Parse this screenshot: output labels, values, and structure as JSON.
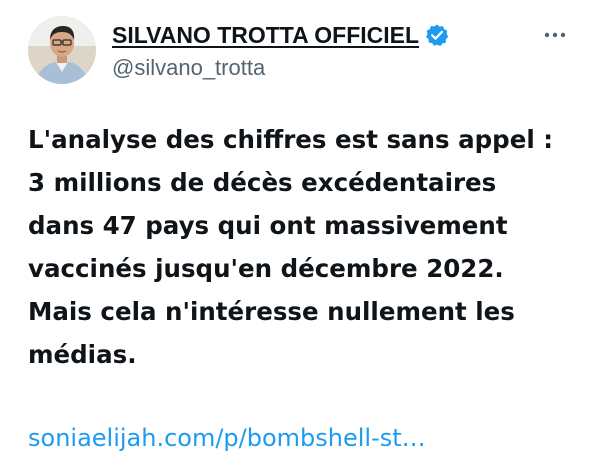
{
  "author": {
    "display_name": "SILVANO TROTTA OFFICIEL",
    "handle": "@silvano_trotta",
    "verified": true,
    "verified_color": "#1d9bf0"
  },
  "menu": {
    "icon": "more-horizontal-icon"
  },
  "tweet": {
    "lines": [
      "L'analyse des chiffres est sans appel :",
      "3 millions de décès excédentaires",
      "dans 47 pays qui ont massivement",
      "vaccinés jusqu'en décembre 2022.",
      "Mais cela n'intéresse nullement les",
      "médias."
    ],
    "link_text": "soniaelijah.com/p/bombshell-st…",
    "link_color": "#1d9bf0"
  }
}
